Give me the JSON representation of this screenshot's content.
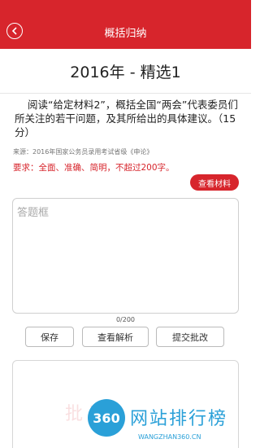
{
  "header": {
    "title": "概括归纳"
  },
  "question_title": "2016年 - 精选1",
  "question": {
    "text": "阅读“给定材料2”，概括全国“两会”代表委员们所关注的若干问题，及其所给出的具体建议。（15分）",
    "source": "来源：2016年国家公务员录用考试省级《申论》",
    "requirement": "要求：全面、准确、简明，不超过200字。",
    "view_material_label": "查看材料"
  },
  "answer": {
    "placeholder": "答题框",
    "value": "",
    "counter": "0/200"
  },
  "actions": {
    "save": "保存",
    "analysis": "查看解析",
    "submit": "提交批改"
  },
  "watermark": {
    "text": "批改",
    "logo_text": "360",
    "brand": "网站排行榜",
    "brand_url": "WANGZHAN360.CN"
  },
  "colors": {
    "accent": "#d7252c",
    "brand": "#2aa0d8"
  }
}
